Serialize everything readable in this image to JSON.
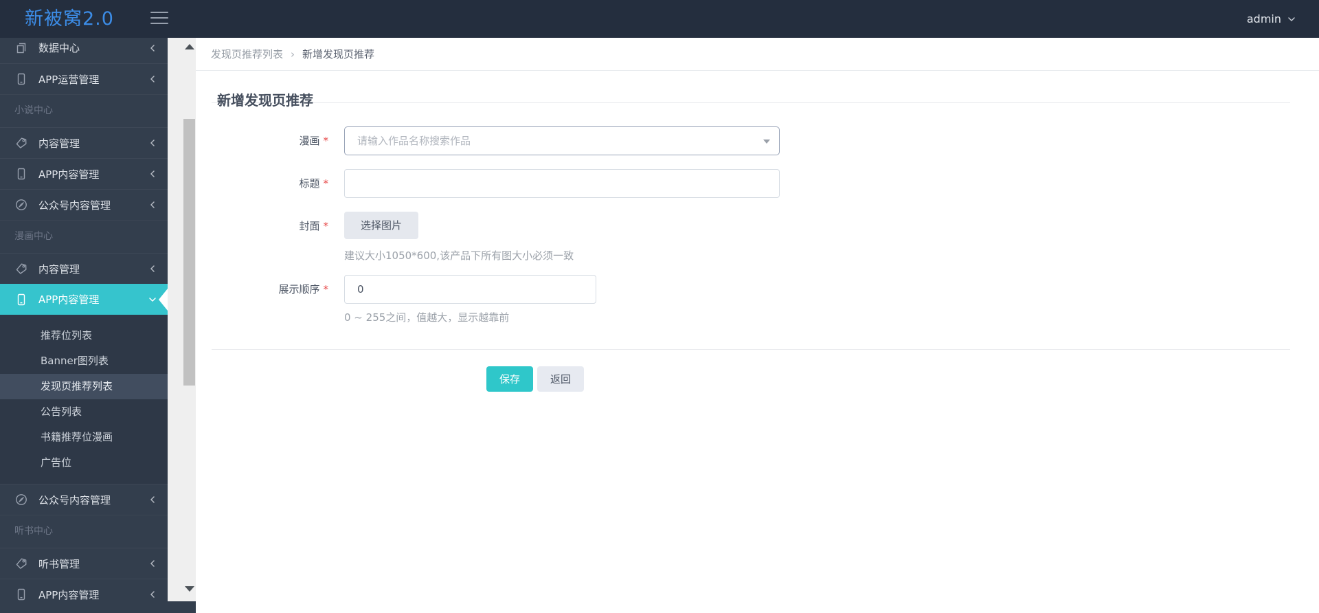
{
  "header": {
    "logo": "新被窝2.0",
    "user": "admin"
  },
  "sidebar": {
    "items": [
      {
        "label": "数据中心"
      },
      {
        "label": "APP运营管理"
      },
      {
        "label": "小说中心"
      },
      {
        "label": "内容管理"
      },
      {
        "label": "APP内容管理"
      },
      {
        "label": "公众号内容管理"
      },
      {
        "label": "漫画中心"
      },
      {
        "label": "内容管理"
      },
      {
        "label": "APP内容管理"
      },
      {
        "label": "公众号内容管理"
      },
      {
        "label": "听书中心"
      },
      {
        "label": "听书管理"
      },
      {
        "label": "APP内容管理"
      }
    ],
    "submenu": [
      {
        "label": "推荐位列表"
      },
      {
        "label": "Banner图列表"
      },
      {
        "label": "发现页推荐列表"
      },
      {
        "label": "公告列表"
      },
      {
        "label": "书籍推荐位漫画"
      },
      {
        "label": "广告位"
      }
    ]
  },
  "breadcrumb": {
    "first": "发现页推荐列表",
    "separator": "›",
    "current": "新增发现页推荐"
  },
  "page": {
    "title": "新增发现页推荐"
  },
  "form": {
    "comic": {
      "label": "漫画",
      "required": "*",
      "placeholder": "请输入作品名称搜索作品"
    },
    "title": {
      "label": "标题",
      "required": "*",
      "value": ""
    },
    "cover": {
      "label": "封面",
      "required": "*",
      "button": "选择图片",
      "hint": "建议大小1050*600,该产品下所有图大小必须一致"
    },
    "order": {
      "label": "展示顺序",
      "required": "*",
      "value": "0",
      "hint": "0 ~ 255之间，值越大，显示越靠前"
    },
    "save_label": "保存",
    "back_label": "返回"
  },
  "colors": {
    "topbar_bg": "#242e3e",
    "sidebar_bg": "#333e4d",
    "accent_teal": "#36c4cd",
    "save_button": "#2fc7ca",
    "logo_blue": "#3c8ce6",
    "required_red": "#e64545"
  }
}
